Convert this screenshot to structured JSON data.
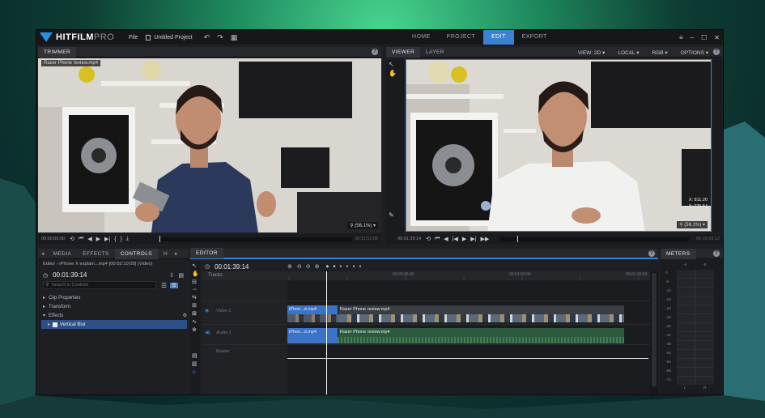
{
  "app": {
    "logo_bold": "HITFILM",
    "logo_light": "PRO",
    "menu_file": "File",
    "project_name": "Untitled Project",
    "undo_icon": "undo-icon",
    "redo_icon": "redo-icon"
  },
  "nav": {
    "tabs": [
      "HOME",
      "PROJECT",
      "EDIT",
      "EXPORT"
    ],
    "active": "EDIT"
  },
  "trimmer": {
    "tab": "TRIMMER",
    "clip_name": "Razer Phone review.mp4",
    "zoom": "(56.1%)",
    "timecode_start": "00:00:00:00",
    "timecode_end": "00:11:51:06"
  },
  "viewer": {
    "tabs": [
      "VIEWER",
      "LAYER"
    ],
    "view_label": "VIEW: 2D",
    "space_label": "LOCAL",
    "color_label": "RGB",
    "options_label": "OPTIONS",
    "zoom": "(56.1%)",
    "coord_x": "X: 811.20",
    "coord_y": "Y: 225.54",
    "timecode": "00:01:39:14",
    "timecode_end": "00:16:03:12"
  },
  "controls": {
    "tabs": [
      "MEDIA",
      "EFFECTS",
      "CONTROLS",
      "H"
    ],
    "breadcrumb": "Editor › iPhone X explain...mp4 [00:02:10:05] (Video)",
    "timecode": "00:01:39:14",
    "search_placeholder": "Search in Controls",
    "rows": [
      "Clip Properties",
      "Transform",
      "Effects"
    ],
    "selected_effect": "Vertical Blur"
  },
  "editor": {
    "tab": "EDITOR",
    "timecode": "00:01:39:14",
    "tracks_header": "Tracks",
    "ruler": [
      "00:00:30:00",
      "00:01:00:00",
      "00:01:30:00"
    ],
    "track_video": "Video 1",
    "track_audio": "Audio 1",
    "track_master": "Master",
    "clip_a_video": "iPhon...d.mp4",
    "clip_b_video": "Razer Phone review.mp4",
    "clip_a_audio": "iPhon...d.mp4",
    "clip_b_audio": "Razer Phone review.mp4"
  },
  "meters": {
    "tab": "METERS",
    "top_values": [
      "-6",
      "-6"
    ],
    "scale": [
      "0",
      "-6",
      "-12",
      "-18",
      "-24",
      "-30",
      "-36",
      "-42",
      "-48",
      "-54",
      "-60",
      "-66",
      "-72"
    ],
    "channels": [
      "L",
      "R"
    ]
  },
  "colors": {
    "accent": "#3b82cf",
    "video_clip": "#3a73c8",
    "audio_clip": "#2d5a3e",
    "playhead": "#ffffff"
  }
}
